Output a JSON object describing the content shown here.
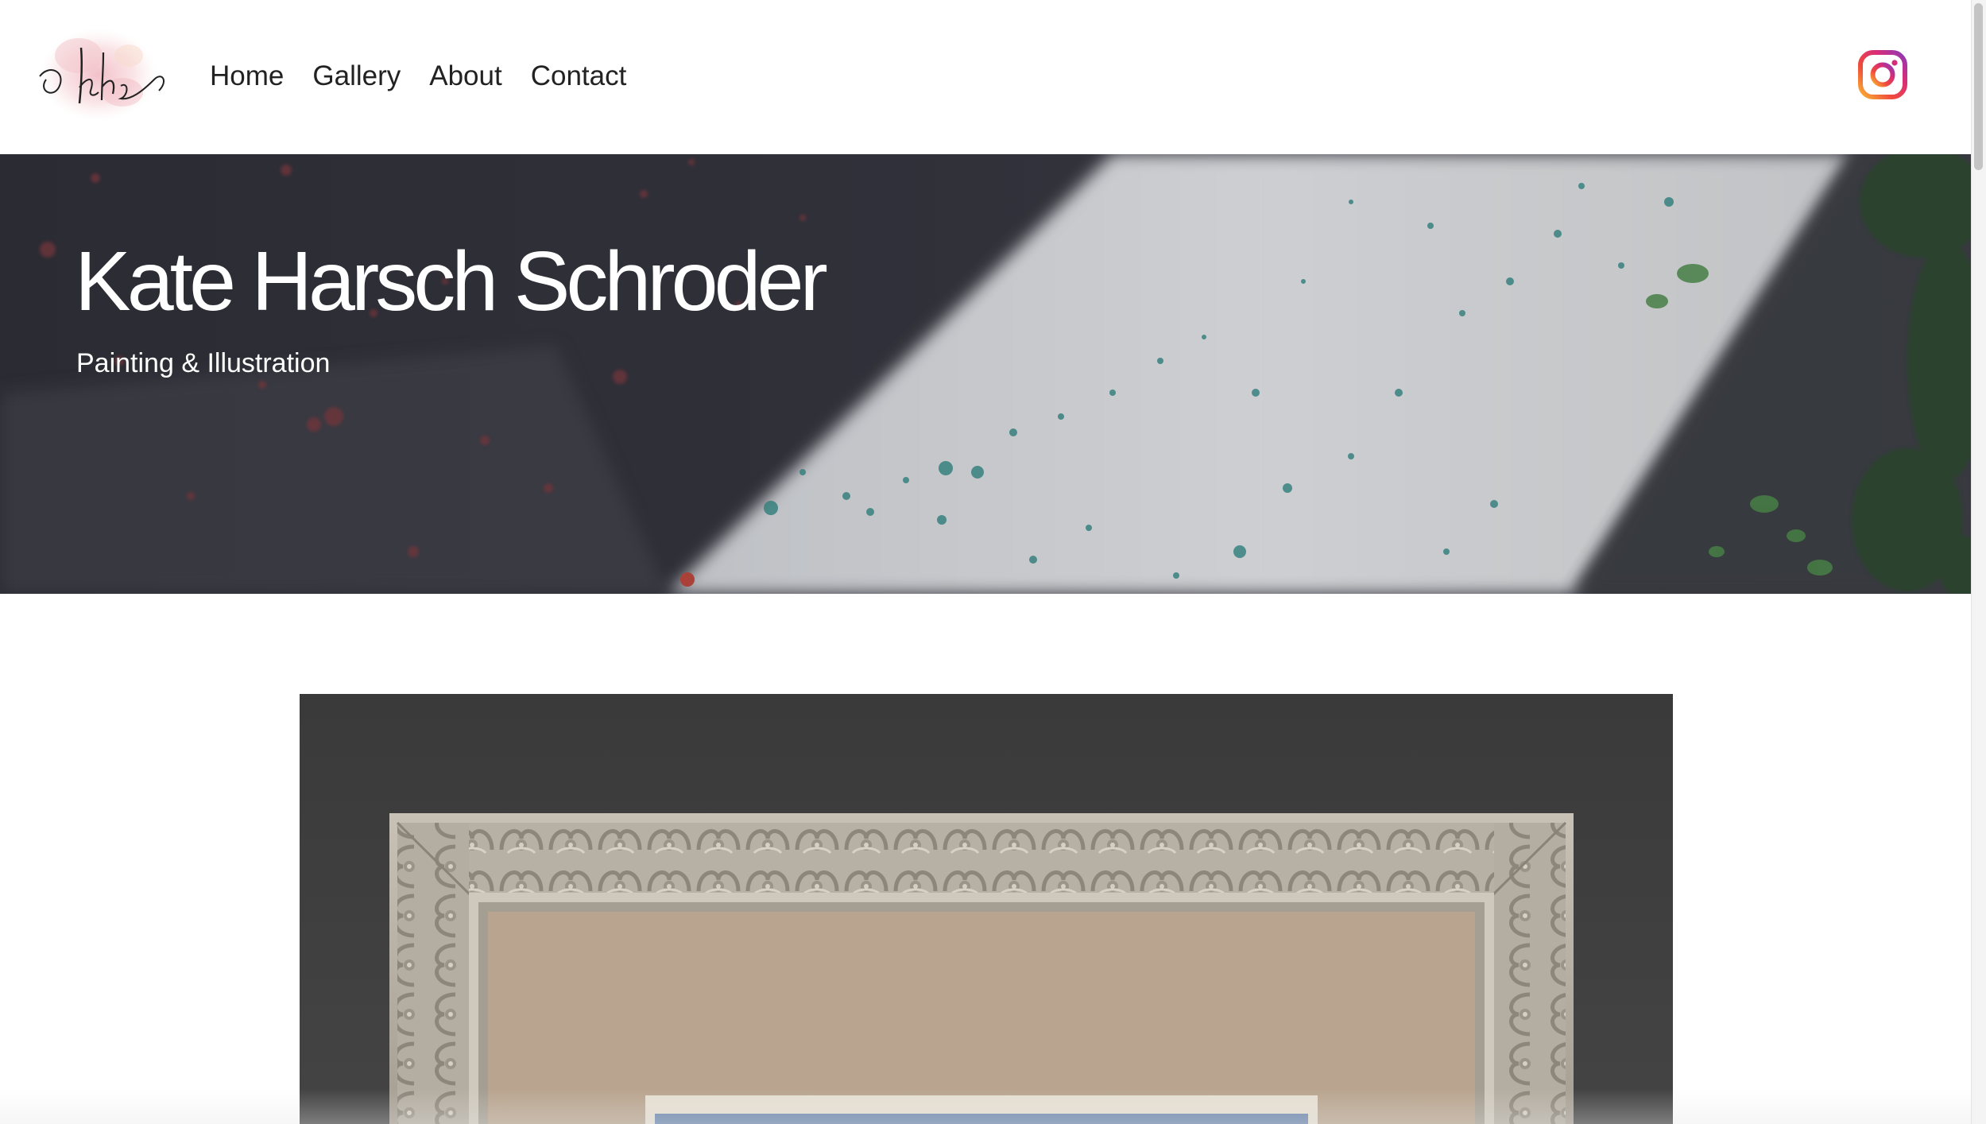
{
  "header": {
    "logo_text": "khs",
    "nav": [
      {
        "label": "Home"
      },
      {
        "label": "Gallery"
      },
      {
        "label": "About"
      },
      {
        "label": "Contact"
      }
    ],
    "social_icon": "instagram-icon"
  },
  "hero": {
    "title": "Kate Harsch Schroder",
    "subtitle": "Painting & Illustration"
  },
  "featured": {
    "description": "framed painting on dark backdrop"
  },
  "colors": {
    "background": "#ffffff",
    "nav_text": "#222222",
    "hero_text": "#ffffff",
    "hero_shadow": "#3b3b45",
    "hero_light": "#d8dadd",
    "artwork_backdrop": "#3d3d3d",
    "frame": "#b2ab9f",
    "mat": "#b9a58f",
    "painting_sky": "#6c87ad"
  }
}
